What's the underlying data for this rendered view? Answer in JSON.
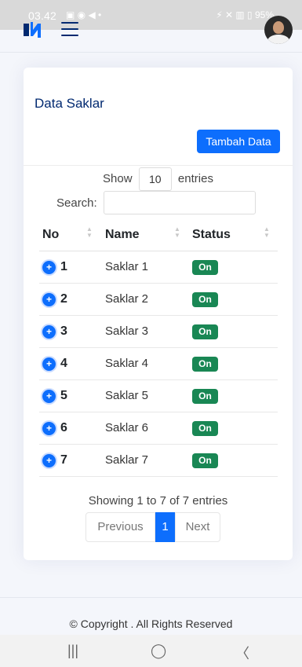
{
  "statusbar": {
    "time": "03.42",
    "left_icons": "▣ ◉ ◀ •",
    "right_icons": "⚡ ✕ ▥ ▯ 95%"
  },
  "header": {
    "logo_icon": "logo-icon",
    "menu_icon": "hamburger-icon",
    "avatar": "user-avatar"
  },
  "card": {
    "title": "Data Saklar",
    "add_button": "Tambah Data",
    "show_label": "Show",
    "entries_select": "10",
    "entries_label": "entries",
    "search_label": "Search:",
    "search_value": ""
  },
  "table": {
    "columns": [
      "No",
      "Name",
      "Status"
    ],
    "rows": [
      {
        "no": "1",
        "name": "Saklar 1",
        "status": "On"
      },
      {
        "no": "2",
        "name": "Saklar 2",
        "status": "On"
      },
      {
        "no": "3",
        "name": "Saklar 3",
        "status": "On"
      },
      {
        "no": "4",
        "name": "Saklar 4",
        "status": "On"
      },
      {
        "no": "5",
        "name": "Saklar 5",
        "status": "On"
      },
      {
        "no": "6",
        "name": "Saklar 6",
        "status": "On"
      },
      {
        "no": "7",
        "name": "Saklar 7",
        "status": "On"
      }
    ]
  },
  "info": "Showing 1 to 7 of 7 entries",
  "pagination": {
    "previous": "Previous",
    "current": "1",
    "next": "Next"
  },
  "footer": "© Copyright . All Rights Reserved",
  "navbar": {
    "recent": "|||",
    "home": "◯",
    "back": "〈"
  },
  "colors": {
    "primary": "#0d6efd",
    "success": "#198754",
    "title": "#012970"
  }
}
